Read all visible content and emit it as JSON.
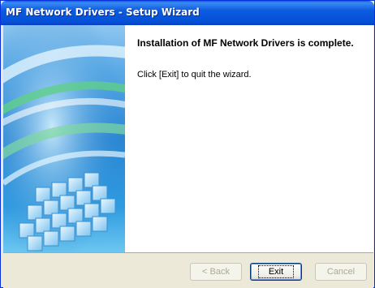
{
  "window": {
    "title": "MF Network Drivers - Setup Wizard"
  },
  "content": {
    "heading": "Installation of MF Network Drivers is complete.",
    "message": "Click [Exit] to quit the wizard."
  },
  "buttons": {
    "back": {
      "label": "< Back",
      "enabled": false
    },
    "exit": {
      "label": "Exit",
      "enabled": true,
      "default": true
    },
    "cancel": {
      "label": "Cancel",
      "enabled": false
    }
  },
  "colors": {
    "titlebar": "#0450d6",
    "panel": "#ece9d8",
    "banner_blue": "#2b86d2"
  }
}
